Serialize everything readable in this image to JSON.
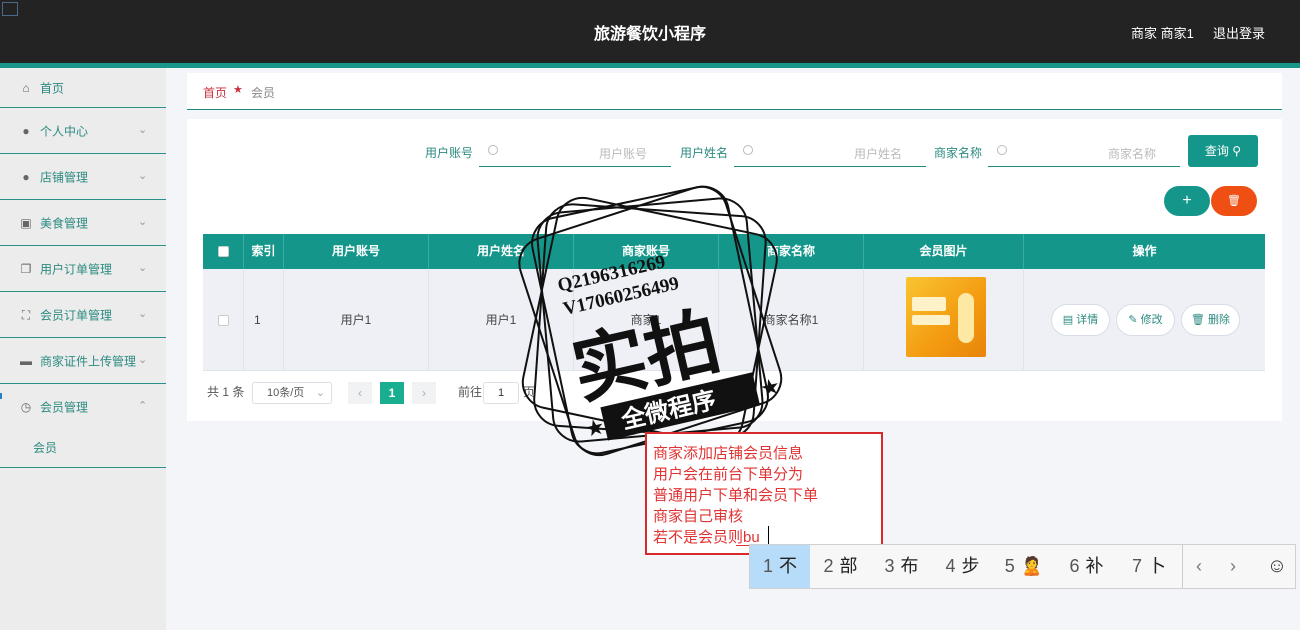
{
  "header": {
    "title": "旅游餐饮小程序",
    "user": "商家 商家1",
    "logout": "退出登录"
  },
  "sidebar": {
    "items": [
      {
        "label": "首页",
        "icon": "home-icon"
      },
      {
        "label": "个人中心",
        "icon": "user-icon"
      },
      {
        "label": "店铺管理",
        "icon": "user-icon"
      },
      {
        "label": "美食管理",
        "icon": "clipboard-icon"
      },
      {
        "label": "用户订单管理",
        "icon": "copy-icon"
      },
      {
        "label": "会员订单管理",
        "icon": "fullscreen-icon"
      },
      {
        "label": "商家证件上传管理",
        "icon": "briefcase-icon"
      },
      {
        "label": "会员管理",
        "icon": "clock-icon"
      }
    ],
    "sub_item": "会员"
  },
  "breadcrumb": {
    "home": "首页",
    "current": "会员"
  },
  "filters": [
    {
      "label": "用户账号",
      "placeholder": "用户账号"
    },
    {
      "label": "用户姓名",
      "placeholder": "用户姓名"
    },
    {
      "label": "商家名称",
      "placeholder": "商家名称"
    }
  ],
  "query_button": "查询",
  "add_symbol": "+",
  "delete_symbol": "🗑",
  "table": {
    "headers": [
      "索引",
      "用户账号",
      "用户姓名",
      "商家账号",
      "商家名称",
      "会员图片",
      "操作"
    ],
    "rows": [
      {
        "index": "1",
        "account": "用户1",
        "name": "用户1",
        "shop_account": "商家1",
        "shop_name": "商家名称1"
      }
    ],
    "actions": {
      "detail": "详情",
      "edit": "修改",
      "delete": "删除"
    }
  },
  "pagination": {
    "total": "共 1 条",
    "page_size": "10条/页",
    "current": "1",
    "goto_label": "前往",
    "goto_value": "1",
    "page_suffix": "页"
  },
  "watermark": {
    "line1": "Q2196316269",
    "line2": "V17060256499",
    "big": "实拍",
    "banner": "全微程序"
  },
  "note": {
    "lines": [
      "商家添加店铺会员信息",
      "用户会在前台下单分为",
      "普通用户下单和会员下单",
      "商家自己审核",
      "若不是会员则bu"
    ]
  },
  "ime": {
    "candidates": [
      {
        "n": "1",
        "c": "不"
      },
      {
        "n": "2",
        "c": "部"
      },
      {
        "n": "3",
        "c": "布"
      },
      {
        "n": "4",
        "c": "步"
      },
      {
        "n": "5",
        "c": "🙎"
      },
      {
        "n": "6",
        "c": "补"
      },
      {
        "n": "7",
        "c": "卜"
      }
    ],
    "prev": "‹",
    "next": "›",
    "emoji": "☺"
  }
}
